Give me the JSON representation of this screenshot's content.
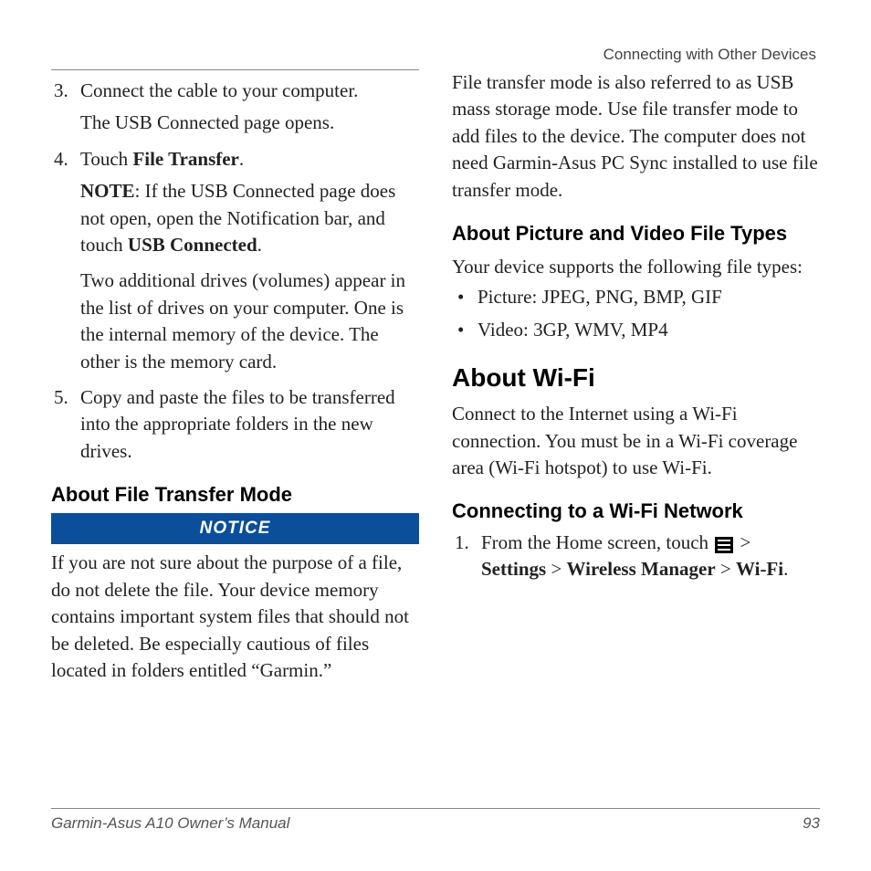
{
  "header": {
    "section": "Connecting with Other Devices"
  },
  "left": {
    "steps": [
      {
        "num": "3.",
        "text": "Connect the cable to your computer.",
        "after": "The USB Connected page opens."
      },
      {
        "num": "4.",
        "text_pre": "Touch ",
        "text_bold": "File Transfer",
        "text_post": ".",
        "note_label": "NOTE",
        "note_rest": ": If the USB Connected page does not open, open the Notification bar, and touch ",
        "note_bold": "USB Connected",
        "note_end": ".",
        "extra": "Two additional drives (volumes) appear in the list of drives on your computer. One is the internal memory of the device. The other is the memory card."
      },
      {
        "num": "5.",
        "text": "Copy and paste the files to be transferred into the appropriate folders in the new drives."
      }
    ],
    "h_transfer": "About File Transfer Mode",
    "notice_label": "NOTICE",
    "notice_text": "If you are not sure about the purpose of a file, do not delete the file. Your device memory contains important system files that should not be deleted. Be especially cautious of files located in folders entitled “Garmin.”"
  },
  "right": {
    "intro": "File transfer mode is also referred to as USB mass storage mode. Use file transfer mode to add files to the device. The computer does not need Garmin-Asus PC Sync installed to use file transfer mode.",
    "h_types": "About Picture and Video File Types",
    "types_intro": "Your device supports the following file types:",
    "types": [
      "Picture: JPEG, PNG, BMP, GIF",
      "Video: 3GP, WMV, MP4"
    ],
    "h_wifi": "About Wi-Fi",
    "wifi_intro": "Connect to the Internet using a Wi-Fi connection. You must be in a Wi-Fi coverage area (Wi-Fi hotspot) to use Wi-Fi.",
    "h_connect": "Connecting to a Wi-Fi Network",
    "connect_step1_pre": "From the Home screen, touch ",
    "gt": " > ",
    "settings": "Settings",
    "wireless_mgr": "Wireless Manager",
    "wifi": "Wi-Fi",
    "period": "."
  },
  "footer": {
    "left": "Garmin-Asus A10 Owner’s Manual",
    "right": "93"
  }
}
